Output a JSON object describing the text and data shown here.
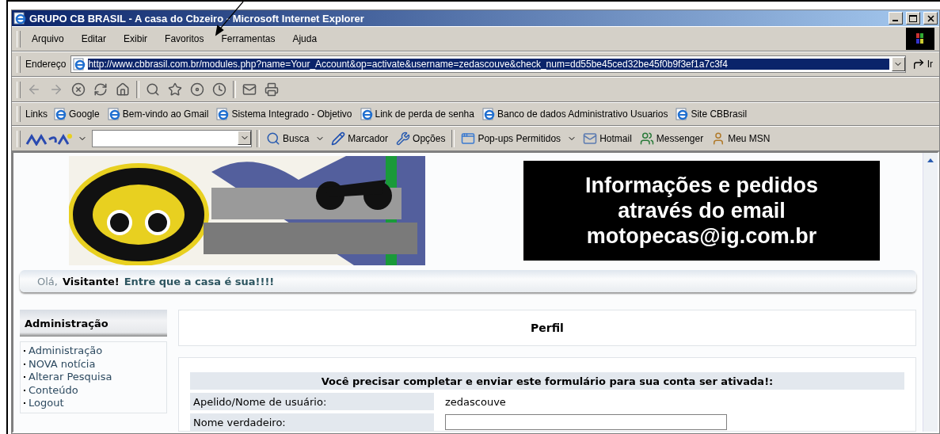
{
  "window": {
    "title": "GRUPO CB BRASIL - A casa do Cbzeiro - Microsoft Internet Explorer"
  },
  "menu": [
    "Arquivo",
    "Editar",
    "Exibir",
    "Favoritos",
    "Ferramentas",
    "Ajuda"
  ],
  "address": {
    "label": "Endereço",
    "value": "http://www.cbbrasil.com.br/modules.php?name=Your_Account&op=activate&username=zedascouve&check_num=dd55be45ced32be45f0b9f3ef1a7c3f4",
    "go": "Ir"
  },
  "links": {
    "label": "Links",
    "items": [
      "Google",
      "Bem-vindo ao Gmail",
      "Sistema Integrado - Objetivo",
      "Link de perda de senha",
      "Banco de dados Administrativo Usuarios",
      "Site CBBrasil"
    ]
  },
  "msn_bar": {
    "items": [
      {
        "kind": "search",
        "label": "Busca",
        "dropdown": true
      },
      {
        "kind": "marker",
        "label": "Marcador",
        "dropdown": false
      },
      {
        "kind": "options",
        "label": "Opções",
        "dropdown": false
      },
      {
        "kind": "popups",
        "label": "Pop-ups Permitidos",
        "dropdown": true
      },
      {
        "kind": "mail",
        "label": "Hotmail",
        "dropdown": false
      },
      {
        "kind": "messenger",
        "label": "Messenger",
        "dropdown": false
      },
      {
        "kind": "person",
        "label": "Meu MSN",
        "dropdown": false
      }
    ]
  },
  "ad": {
    "lines": [
      "Informações e pedidos",
      "através do email",
      "motopecas@ig.com.br"
    ]
  },
  "greeting": {
    "hello": "Olá,",
    "name": "Visitante!",
    "message": "Entre que a casa é sua!!!!"
  },
  "sidebar": {
    "title": "Administração",
    "items": [
      "Administração",
      "NOVA notícia",
      "Alterar Pesquisa",
      "Conteúdo",
      "Logout"
    ]
  },
  "main": {
    "title": "Perfil",
    "form": {
      "header": "Você precisar completar e enviar este formulário para sua conta ser ativada!:",
      "rows": [
        {
          "kind": "text",
          "label": "Apelido/Nome de usuário:",
          "value": "zedascouve"
        },
        {
          "kind": "input",
          "label": "Nome verdadeiro:"
        }
      ]
    }
  }
}
